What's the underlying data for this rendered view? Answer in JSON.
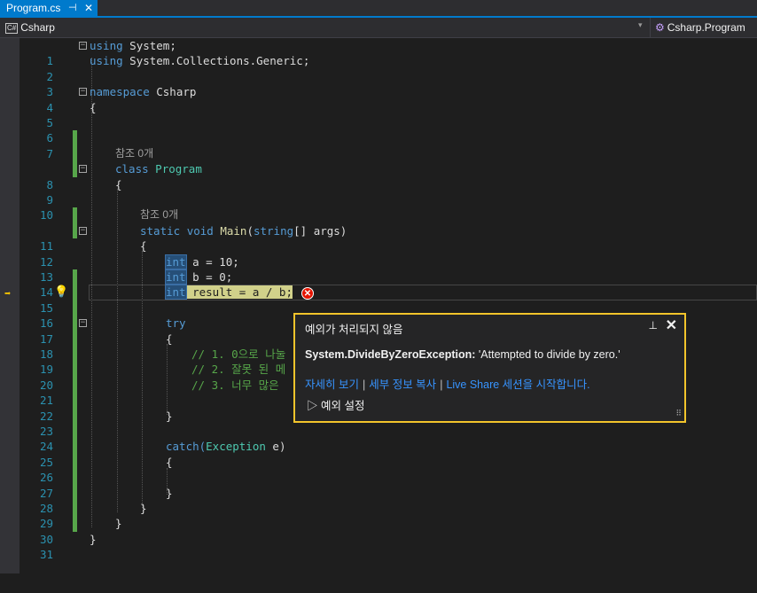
{
  "tab": {
    "title": "Program.cs",
    "pin": "⊣",
    "close": "✕"
  },
  "navbar": {
    "badge": "C#",
    "project": "Csharp",
    "dropdown": "▾",
    "class_path": "Csharp.Program"
  },
  "lines": [
    {
      "n": "1"
    },
    {
      "n": "2"
    },
    {
      "n": "3"
    },
    {
      "n": "4"
    },
    {
      "n": "5"
    },
    {
      "n": "6"
    },
    {
      "n": "7"
    },
    {
      "n": "8"
    },
    {
      "n": "9"
    },
    {
      "n": "10"
    },
    {
      "n": "11"
    },
    {
      "n": "12"
    },
    {
      "n": "13"
    },
    {
      "n": "14"
    },
    {
      "n": "15"
    },
    {
      "n": "16"
    },
    {
      "n": "17"
    },
    {
      "n": "18"
    },
    {
      "n": "19"
    },
    {
      "n": "20"
    },
    {
      "n": "21"
    },
    {
      "n": "22"
    },
    {
      "n": "23"
    },
    {
      "n": "24"
    },
    {
      "n": "25"
    },
    {
      "n": "26"
    },
    {
      "n": "27"
    },
    {
      "n": "28"
    },
    {
      "n": "29"
    },
    {
      "n": "30"
    },
    {
      "n": "31"
    }
  ],
  "code": {
    "l1_kw": "using",
    "l1_rest": " System;",
    "l2_kw": "using",
    "l2_rest": " System.Collections.Generic;",
    "l4_kw": "namespace",
    "l4_rest": " Csharp",
    "brace_open": "{",
    "brace_close": "}",
    "ref_class": "참조 0개",
    "l8_kw": "class",
    "l8_name": "Program",
    "ref_main": "참조 0개",
    "l11_static": "static",
    "l11_void": "void",
    "l11_main": "Main",
    "l11_paren": "(",
    "l11_string": "string",
    "l11_args": "[] args)",
    "l13_type": "int",
    "l13_rest": " a = 10;",
    "l14_type": "int",
    "l14_rest": " b = 0;",
    "l15_type": "int",
    "l15_rest": " result = a / b;",
    "l17_try": "try",
    "l19_cm": "// 1. 0으로 나눌",
    "l20_cm": "// 2. 잘못 된 메",
    "l21_cm": "// 3. 너무 많은",
    "l25_catch": "catch(",
    "l25_type": "Exception",
    "l25_rest": " e)"
  },
  "popup": {
    "title": "예외가 처리되지 않음",
    "pin": "⊥",
    "close": "✕",
    "exception_type": "System.DivideByZeroException:",
    "message": " 'Attempted to divide by zero.'",
    "link1": "자세히 보기",
    "link2": "세부 정보 복사",
    "link3": "Live Share 세션을 시작합니다.",
    "separator": "|",
    "settings": "예외 설정",
    "settings_arrow": "▷",
    "grip": "⠿"
  },
  "colors": {
    "accent": "#007acc",
    "popup_border": "#f2c42b",
    "error": "#e51400",
    "change_bar": "#57a64a"
  }
}
